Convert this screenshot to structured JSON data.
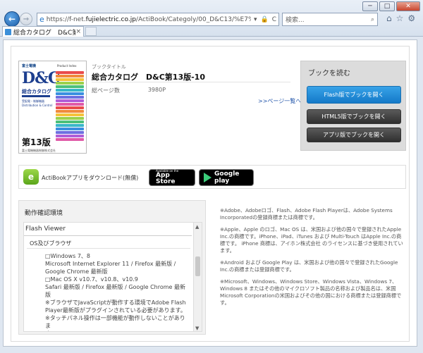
{
  "window": {
    "minimize": "─",
    "maximize": "□",
    "close": "✕"
  },
  "nav": {
    "back": "←",
    "forward": "→"
  },
  "address": {
    "url_prefix": "https://f-net.",
    "url_domain": "fujielectric.co.jp",
    "url_rest": "/ActiBook/Categoly/00_D&C13/%E7%B7%8F%E5%90%88%",
    "tools": [
      "▾",
      "🔒",
      "C"
    ]
  },
  "search": {
    "placeholder": "検索...",
    "icon": "⌕"
  },
  "toolbar_icons": [
    "⌂",
    "☆",
    "⚙"
  ],
  "tab": {
    "label": "総合カタログ　D&C第13...",
    "close": "×"
  },
  "book": {
    "cover": {
      "brand": "富士電機",
      "logo": "D&C",
      "catalog": "総合カタログ",
      "subtitle": "受配電・制御機器 Distribution & Control",
      "edition_number": "第13版",
      "top_text": "Product Index",
      "footer": "富士電機機器制御株式会社"
    },
    "title_caption": "ブックタイトル",
    "title": "総合カタログ　D&C第13版-10",
    "pages_label": "総ページ数",
    "pages_value": "3980P",
    "pagelist_link": ">>ページ一覧へ"
  },
  "read": {
    "title": "ブックを読む",
    "flash_button": "Flash版でブックを開く",
    "html5_button": "HTML5版でブックを開く",
    "app_button": "アプリ版でブックを開く"
  },
  "app_download": {
    "label": "ActiBookアプリをダウンロード(無償)",
    "appstore_small": "Available on the",
    "appstore_big": "App Store",
    "gplay_big": "Google play"
  },
  "environment": {
    "title": "動作確認環境",
    "section": "Flash Viewer",
    "subsection": "OS及びブラウザ",
    "lines": [
      "□Windows 7、8",
      "Microsoft Internet Explorer 11 / Firefox 最新版 /",
      "Google Chrome 最新版",
      "□Mac OS X v10.7、v10.8、v10.9",
      "Safari 最新版 / Firefox 最新版 / Google Chrome 最新版",
      "※ブラウザでJavaScriptが動作する環境でAdobe Flash",
      "Player最新版がプラグインされている必要があります。",
      "※タッチパネル操作は一部機能が動作しないことがありま",
      "す。"
    ]
  },
  "legal": [
    "※Adobe、Adobeロゴ、Flash、Adobe Flash Playerは、Adobe Systems Incorporatedの登録商標または商標です。",
    "※Apple、Apple のロゴ、Mac OS は、米国および他の国々で登録されたApple Inc.の商標です。iPhone、iPad、iTunes および Multi-Touch はApple Inc.の商標です。 iPhone 商標は、アイホン株式会社 のライセンスに基づき使用されています。",
    "※Android および Google Play は、米国および他の国々で登録されたGoogle Inc.の商標または登録商標です。",
    "※Microsoft、Windows、Windows Store、Windows Vista、Windows 7、Windows 8 またはその他のマイクロソフト製品の名称および製品名は、米国 Microsoft Corporationの米国およびその他の国における商標または登録商標です。"
  ],
  "colors": {
    "flash_button": "#1e86d6",
    "dark_button": "#3a3a3a",
    "link": "#2255aa"
  }
}
